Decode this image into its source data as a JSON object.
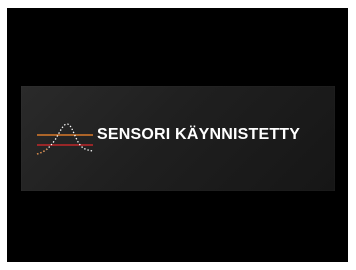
{
  "notification": {
    "message": "SENSORI KÄYNNISTETTY",
    "icon": "sensor-waveform-icon"
  },
  "colors": {
    "screen_background": "#000000",
    "banner_background": "#222222",
    "text": "#ffffff",
    "upper_line": "#d97a2b",
    "lower_line": "#c0282a",
    "curve": "#ffffff"
  }
}
